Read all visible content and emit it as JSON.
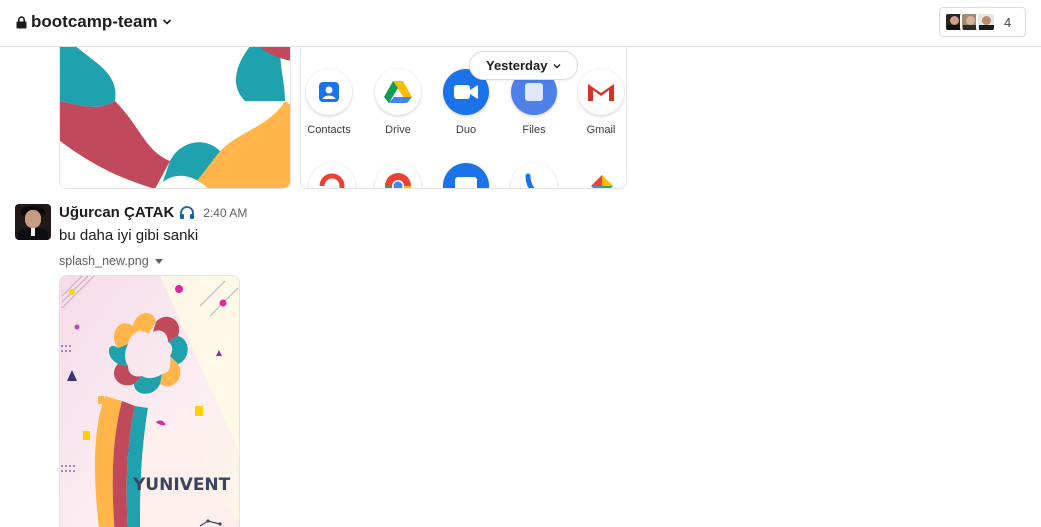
{
  "header": {
    "channel_name": "bootcamp-team",
    "member_count": "4"
  },
  "divider": {
    "label": "Yesterday"
  },
  "apps": [
    {
      "label": "Contacts",
      "icon": "contacts-icon"
    },
    {
      "label": "Drive",
      "icon": "drive-icon"
    },
    {
      "label": "Duo",
      "icon": "duo-icon"
    },
    {
      "label": "Files",
      "icon": "files-icon"
    },
    {
      "label": "Gmail",
      "icon": "gmail-icon"
    }
  ],
  "message": {
    "author": "Uğurcan ÇATAK",
    "status_icon": "headphones-icon",
    "timestamp": "2:40 AM",
    "text": "bu daha iyi gibi sanki",
    "attachment": {
      "file_name": "splash_new.png",
      "brand_text": "YUNIVENT"
    }
  },
  "colors": {
    "teal": "#1fa2ad",
    "red": "#c04a5c",
    "orange": "#ffb54a",
    "pink": "#f7d7e4",
    "navy": "#3b4460"
  }
}
